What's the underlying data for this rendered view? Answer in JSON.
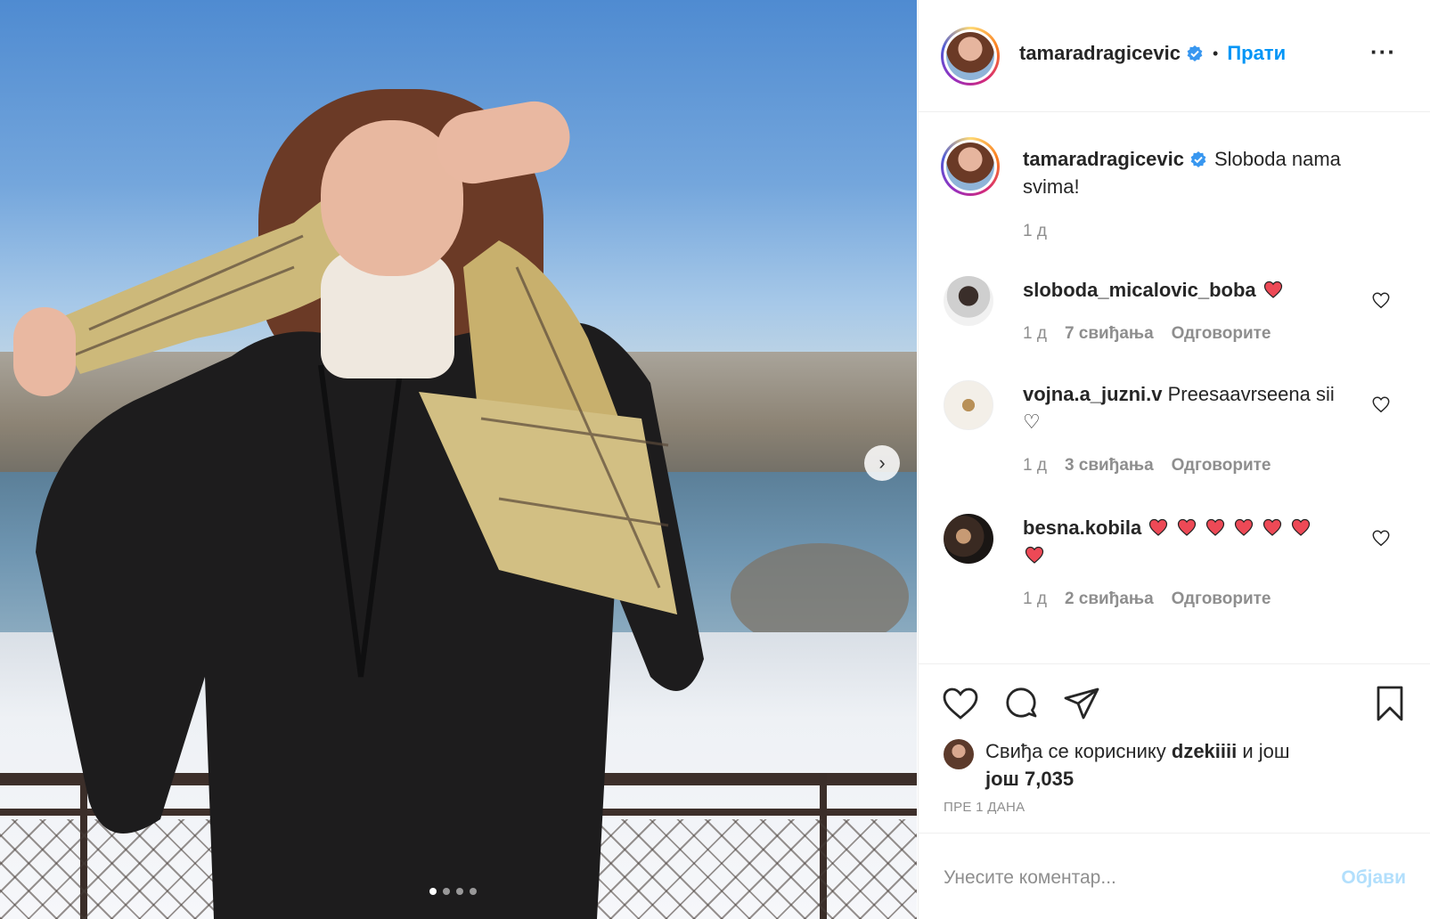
{
  "post": {
    "image_dots": 4,
    "active_dot": 0
  },
  "header": {
    "username": "tamaradragicevic",
    "separator": "•",
    "follow_label": "Прати",
    "more_label": "···"
  },
  "caption": {
    "username": "tamaradragicevic",
    "text": "Sloboda nama svima!",
    "time": "1 д"
  },
  "comments": [
    {
      "username": "sloboda_micalovic_boba",
      "text": "",
      "hearts": 1,
      "time": "1 д",
      "likes": "7 свиђања",
      "reply": "Одговорите"
    },
    {
      "username": "vojna.a_juzni.v",
      "text": "Preesaavrseena sii ♡",
      "hearts": 0,
      "time": "1 д",
      "likes": "3 свиђања",
      "reply": "Одговорите"
    },
    {
      "username": "besna.kobila",
      "text": "",
      "hearts": 7,
      "time": "1 д",
      "likes": "2 свиђања",
      "reply": "Одговорите"
    }
  ],
  "likes": {
    "prefix": "Свиђа се кориснику",
    "user": "dzekiiii",
    "middle": "и још",
    "count": "још 7,035"
  },
  "timestamp": "ПРЕ 1 ДАНА",
  "add_comment": {
    "placeholder": "Унесите коментар...",
    "post_label": "Објави"
  },
  "colors": {
    "accent": "#0095f6",
    "verified": "#3897f0",
    "heart": "#ed4956",
    "post_disabled": "#b2dffc"
  }
}
